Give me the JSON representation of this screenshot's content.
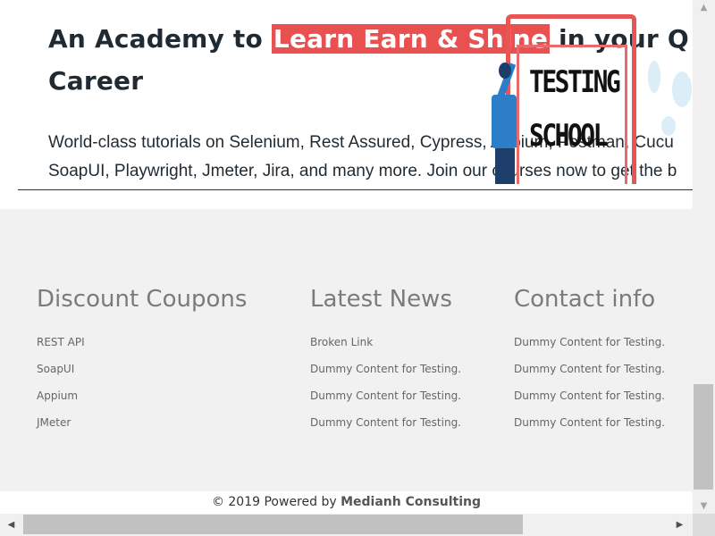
{
  "hero": {
    "headline_prefix": "An Academy to ",
    "headline_highlight": "Learn Earn & Shine",
    "headline_suffix": "  in your Q",
    "headline_line2": "Career",
    "desc_line1": "World-class tutorials on Selenium, Rest Assured, Cypress, Appium, Postman, Cucu",
    "desc_line2": "SoapUI, Playwright, Jmeter, Jira, and many more. Join our courses now to get the b",
    "board_line1": "TESTING",
    "board_line2": "SCHOOL"
  },
  "footer": {
    "columns": [
      {
        "title": "Discount Coupons",
        "items": [
          "REST API",
          "SoapUI",
          "Appium",
          "JMeter"
        ]
      },
      {
        "title": "Latest News",
        "items": [
          "Broken Link",
          "Dummy Content for Testing.",
          "Dummy Content for Testing.",
          "Dummy Content for Testing."
        ]
      },
      {
        "title": "Contact info",
        "items": [
          "Dummy Content for Testing.",
          "Dummy Content for Testing.",
          "Dummy Content for Testing.",
          "Dummy Content for Testing."
        ]
      }
    ],
    "copyright_prefix": "© 2019 Powered by ",
    "copyright_brand": "Medianh Consulting"
  },
  "icons": {
    "scroll_up": "▲",
    "scroll_down": "▼",
    "scroll_left": "◀",
    "scroll_right": "▶"
  },
  "colors": {
    "highlight": "#e95151",
    "footer_bg": "#f1f1f1",
    "heading": "#1f2a33"
  }
}
